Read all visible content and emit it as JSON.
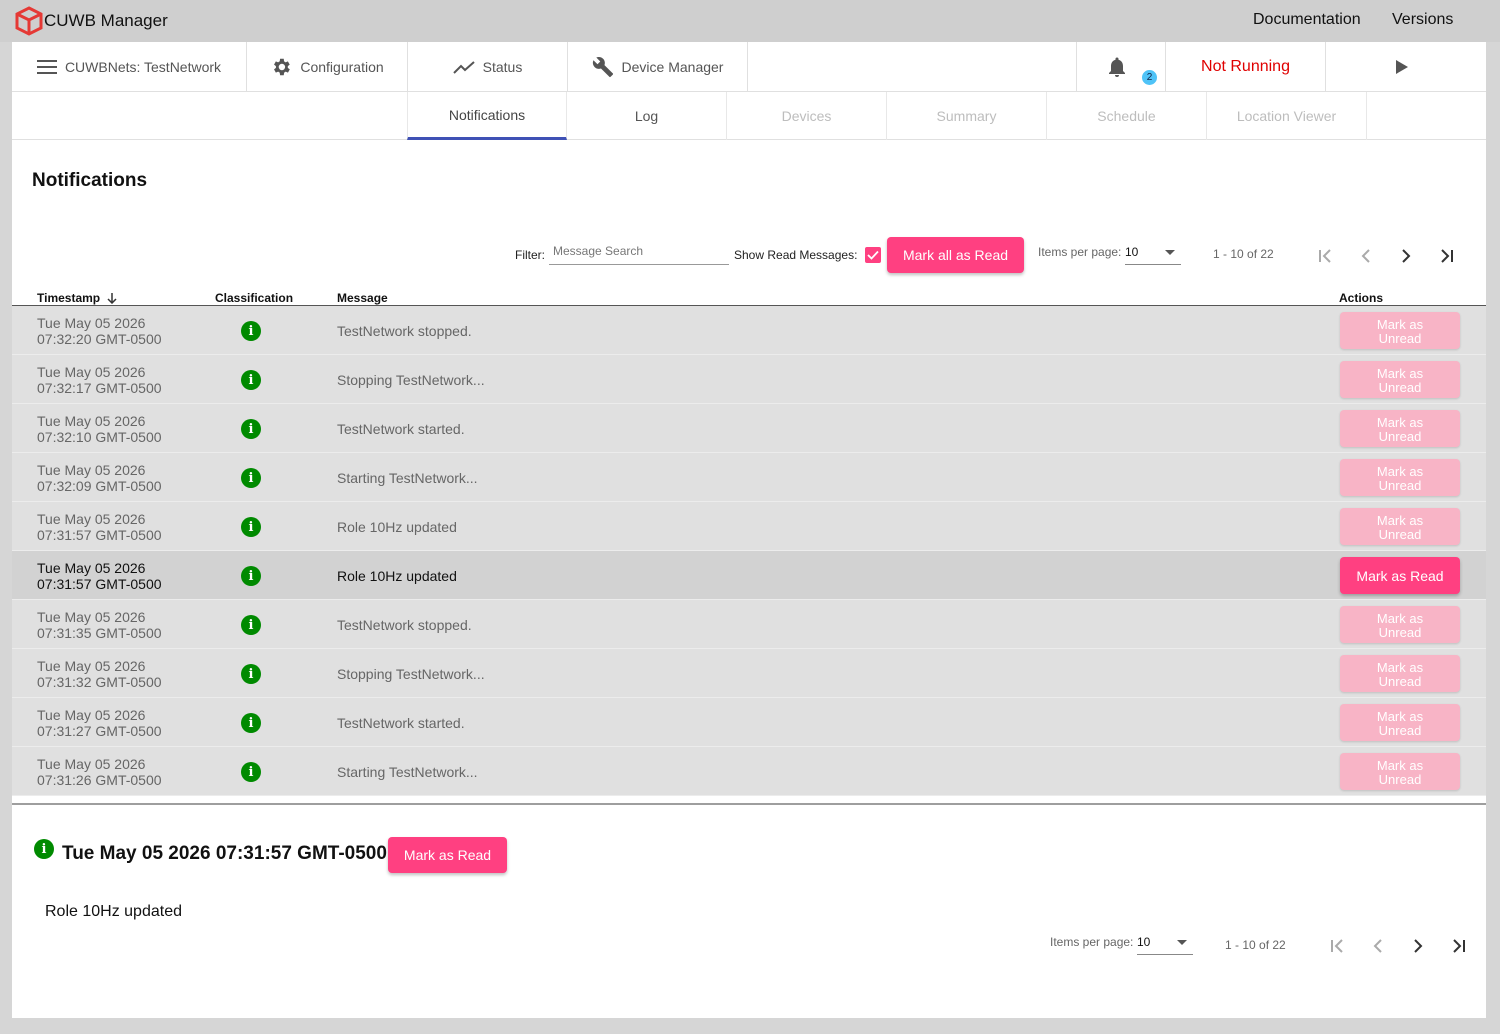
{
  "app": {
    "title": "CUWB Manager",
    "links": [
      "Documentation",
      "Versions"
    ]
  },
  "nav": {
    "network": "CUWBNets: TestNetwork",
    "configuration": "Configuration",
    "status": "Status",
    "device_manager": "Device Manager",
    "notification_count": "2",
    "run_state": "Not Running"
  },
  "tabs": [
    {
      "label": "Notifications",
      "state": "active"
    },
    {
      "label": "Log",
      "state": "enabled"
    },
    {
      "label": "Devices",
      "state": "disabled"
    },
    {
      "label": "Summary",
      "state": "disabled"
    },
    {
      "label": "Schedule",
      "state": "disabled"
    },
    {
      "label": "Location Viewer",
      "state": "disabled"
    }
  ],
  "page": {
    "title": "Notifications"
  },
  "toolbar": {
    "filter_label": "Filter:",
    "search_placeholder": "Message Search",
    "show_read_label": "Show Read Messages:",
    "show_read_checked": true,
    "mark_all_label": "Mark all as Read"
  },
  "paginator": {
    "items_label": "Items per page:",
    "items_value": "10",
    "range": "1 - 10 of 22"
  },
  "table": {
    "headers": {
      "timestamp": "Timestamp",
      "classification": "Classification",
      "message": "Message",
      "actions": "Actions"
    },
    "rows": [
      {
        "ts1": "Tue May 05 2026",
        "ts2": "07:32:20 GMT-0500",
        "message": "TestNetwork stopped.",
        "action_l1": "Mark as",
        "action_l2": "Unread",
        "read": true
      },
      {
        "ts1": "Tue May 05 2026",
        "ts2": "07:32:17 GMT-0500",
        "message": "Stopping TestNetwork...",
        "action_l1": "Mark as",
        "action_l2": "Unread",
        "read": true
      },
      {
        "ts1": "Tue May 05 2026",
        "ts2": "07:32:10 GMT-0500",
        "message": "TestNetwork started.",
        "action_l1": "Mark as",
        "action_l2": "Unread",
        "read": true
      },
      {
        "ts1": "Tue May 05 2026",
        "ts2": "07:32:09 GMT-0500",
        "message": "Starting TestNetwork...",
        "action_l1": "Mark as",
        "action_l2": "Unread",
        "read": true
      },
      {
        "ts1": "Tue May 05 2026",
        "ts2": "07:31:57 GMT-0500",
        "message": "Role 10Hz updated",
        "action_l1": "Mark as",
        "action_l2": "Unread",
        "read": true
      },
      {
        "ts1": "Tue May 05 2026",
        "ts2": "07:31:57 GMT-0500",
        "message": "Role 10Hz updated",
        "action_l1": "Mark as Read",
        "action_l2": "",
        "read": false
      },
      {
        "ts1": "Tue May 05 2026",
        "ts2": "07:31:35 GMT-0500",
        "message": "TestNetwork stopped.",
        "action_l1": "Mark as",
        "action_l2": "Unread",
        "read": true
      },
      {
        "ts1": "Tue May 05 2026",
        "ts2": "07:31:32 GMT-0500",
        "message": "Stopping TestNetwork...",
        "action_l1": "Mark as",
        "action_l2": "Unread",
        "read": true
      },
      {
        "ts1": "Tue May 05 2026",
        "ts2": "07:31:27 GMT-0500",
        "message": "TestNetwork started.",
        "action_l1": "Mark as",
        "action_l2": "Unread",
        "read": true
      },
      {
        "ts1": "Tue May 05 2026",
        "ts2": "07:31:26 GMT-0500",
        "message": "Starting TestNetwork...",
        "action_l1": "Mark as",
        "action_l2": "Unread",
        "read": true
      }
    ]
  },
  "detail": {
    "timestamp": "Tue May 05 2026 07:31:57 GMT-0500",
    "button": "Mark as Read",
    "message": "Role 10Hz updated"
  },
  "colors": {
    "accent": "#ff4081",
    "accent_faded": "#f8b4c6",
    "info": "#008a00",
    "tab_indicator": "#3f51b5",
    "error": "#e00000",
    "badge": "#4fc3f7"
  }
}
